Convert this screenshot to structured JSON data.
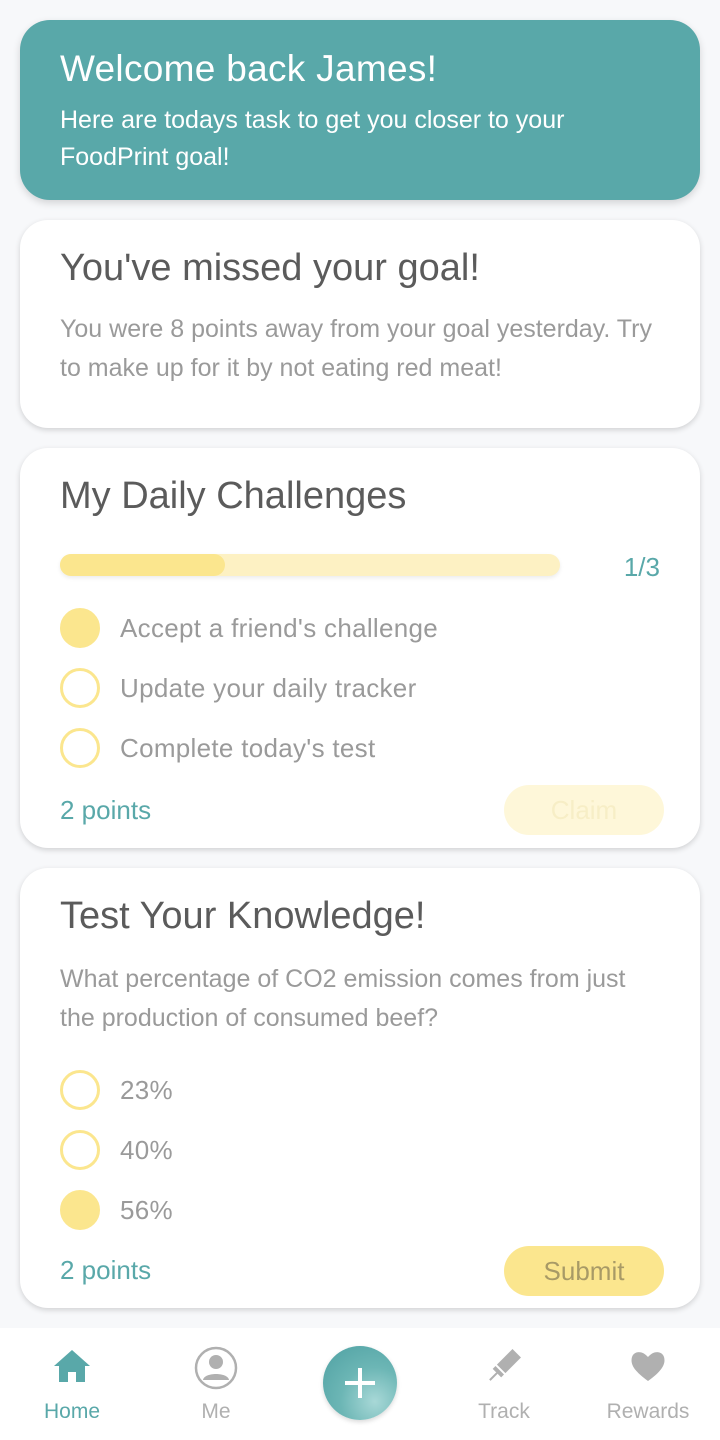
{
  "welcome": {
    "title": "Welcome back James!",
    "subtitle": "Here are todays task to get you closer to your FoodPrint goal!"
  },
  "missed_goal": {
    "title": "You've missed your goal!",
    "message": "You were 8 points away from your goal yesterday. Try to make up for it by not eating red meat!"
  },
  "daily_challenges": {
    "title": "My Daily Challenges",
    "progress_text": "1/3",
    "progress_fraction": 0.33,
    "items": [
      {
        "label": "Accept a friend's challenge",
        "done": true
      },
      {
        "label": "Update your daily tracker",
        "done": false
      },
      {
        "label": "Complete today's test",
        "done": false
      }
    ],
    "points": "2 points",
    "claim_label": "Claim"
  },
  "quiz": {
    "title": "Test Your Knowledge!",
    "question": "What percentage of CO2 emission comes from just the production of consumed beef?",
    "options": [
      {
        "label": "23%",
        "selected": false
      },
      {
        "label": "40%",
        "selected": false
      },
      {
        "label": "56%",
        "selected": true
      }
    ],
    "points": "2 points",
    "submit_label": "Submit"
  },
  "nav": {
    "items": [
      {
        "label": "Home",
        "icon": "home-icon",
        "active": true
      },
      {
        "label": "Me",
        "icon": "profile-icon",
        "active": false
      },
      {
        "label": "Track",
        "icon": "pencil-icon",
        "active": false
      },
      {
        "label": "Rewards",
        "icon": "heart-icon",
        "active": false
      }
    ],
    "add_icon": "plus-icon"
  },
  "colors": {
    "teal": "#59a8a9",
    "yellow": "#fbe68e",
    "yellow_light": "#fdf1c3",
    "text_dark": "#5b5b5b",
    "text_muted": "#9a9a9a"
  }
}
